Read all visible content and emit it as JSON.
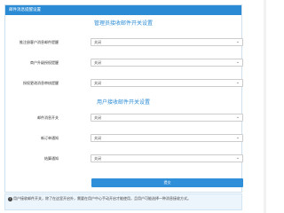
{
  "panel": {
    "title": "邮件消息提醒设置"
  },
  "admin_section": {
    "title": "管理员接收邮件开关设置",
    "rows": [
      {
        "label": "推注册客户消息邮件提醒",
        "value": "关闭"
      },
      {
        "label": "商户升级授权提醒",
        "value": "关闭"
      },
      {
        "label": "授权更改消息审核提醒",
        "value": "关闭"
      }
    ]
  },
  "user_section": {
    "title": "用户接收邮件开关设置",
    "rows": [
      {
        "label": "邮件消息开关",
        "value": "关闭"
      },
      {
        "label": "新订单通知",
        "value": "关闭"
      },
      {
        "label": "结算通知",
        "value": "关闭"
      }
    ]
  },
  "submit_label": "提交",
  "note": {
    "text": "用户接收邮件开关，除了在这里开启外，需要在用户中心手动开启才能使用，且用户可能选择一种消息接收方式。"
  },
  "icons": {
    "dropdown": "chevron-down-icon",
    "info": "info-icon"
  },
  "colors": {
    "header": "#2a8bd4",
    "accent": "#2a8bd4",
    "button": "#2f8fd8",
    "note_bg": "#ecf5fc"
  }
}
